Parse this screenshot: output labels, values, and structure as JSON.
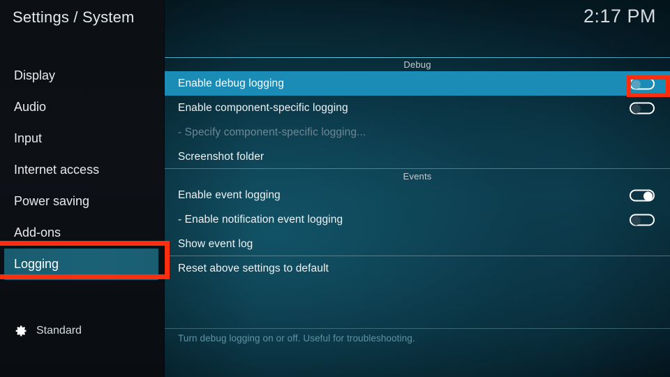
{
  "header": {
    "title": "Settings / System",
    "clock": "2:17 PM"
  },
  "sidebar": {
    "items": [
      {
        "label": "Display",
        "selected": false
      },
      {
        "label": "Audio",
        "selected": false
      },
      {
        "label": "Input",
        "selected": false
      },
      {
        "label": "Internet access",
        "selected": false
      },
      {
        "label": "Power saving",
        "selected": false
      },
      {
        "label": "Add-ons",
        "selected": false
      },
      {
        "label": "Logging",
        "selected": true
      }
    ],
    "profile": {
      "icon": "gear-icon",
      "label": "Standard"
    }
  },
  "settings": {
    "groups": [
      {
        "header": "Debug",
        "rows": [
          {
            "label": "Enable debug logging",
            "control": "toggle",
            "toggle_state": "off",
            "selected": true,
            "disabled": false,
            "rule_below": false
          },
          {
            "label": "Enable component-specific logging",
            "control": "toggle",
            "toggle_state": "off",
            "selected": false,
            "disabled": false,
            "rule_below": false
          },
          {
            "label": "- Specify component-specific logging...",
            "control": "none",
            "toggle_state": null,
            "selected": false,
            "disabled": true,
            "rule_below": false
          },
          {
            "label": "Screenshot folder",
            "control": "none",
            "toggle_state": null,
            "selected": false,
            "disabled": false,
            "rule_below": true
          }
        ]
      },
      {
        "header": "Events",
        "rows": [
          {
            "label": "Enable event logging",
            "control": "toggle",
            "toggle_state": "on",
            "selected": false,
            "disabled": false,
            "rule_below": false
          },
          {
            "label": "- Enable notification event logging",
            "control": "toggle",
            "toggle_state": "off",
            "selected": false,
            "disabled": false,
            "rule_below": false
          },
          {
            "label": "Show event log",
            "control": "none",
            "toggle_state": null,
            "selected": false,
            "disabled": false,
            "rule_below": true
          },
          {
            "label": "Reset above settings to default",
            "control": "none",
            "toggle_state": null,
            "selected": false,
            "disabled": false,
            "rule_below": false
          }
        ]
      }
    ]
  },
  "help": {
    "text": "Turn debug logging on or off. Useful for troubleshooting."
  },
  "annotations": {
    "accent_color": "#fa2f10",
    "boxes": [
      {
        "name": "logging-sidebar-item"
      },
      {
        "name": "debug-logging-toggle"
      }
    ]
  },
  "colors": {
    "selected_row": "#1a8cb5",
    "sidebar_selected": "#1b6175",
    "help_text": "#5f93a6",
    "annotation_red": "#fa2f10"
  }
}
